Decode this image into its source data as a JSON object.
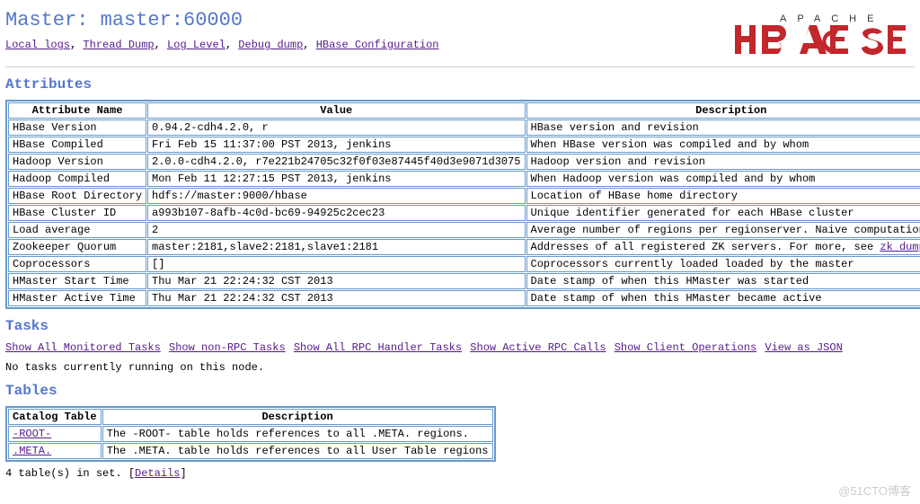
{
  "header": {
    "title": "Master: master:60000",
    "links": [
      "Local logs",
      "Thread Dump",
      "Log Level",
      "Debug dump",
      "HBase Configuration"
    ]
  },
  "sections": {
    "attributes": "Attributes",
    "tasks": "Tasks",
    "tables": "Tables"
  },
  "attributes": {
    "headers": [
      "Attribute Name",
      "Value",
      "Description"
    ],
    "rows": [
      {
        "name": "HBase Version",
        "value": "0.94.2-cdh4.2.0, r",
        "desc": "HBase version and revision"
      },
      {
        "name": "HBase Compiled",
        "value": "Fri Feb 15 11:37:00 PST 2013, jenkins",
        "desc": "When HBase version was compiled and by whom"
      },
      {
        "name": "Hadoop Version",
        "value": "2.0.0-cdh4.2.0, r7e221b24705c32f0f03e87445f40d3e9071d3075",
        "desc": "Hadoop version and revision"
      },
      {
        "name": "Hadoop Compiled",
        "value": "Mon Feb 11 12:27:15 PST 2013, jenkins",
        "desc": "When Hadoop version was compiled and by whom"
      },
      {
        "name": "HBase Root Directory",
        "value": "hdfs://master:9000/hbase",
        "desc": "Location of HBase home directory"
      },
      {
        "name": "HBase Cluster ID",
        "value": "a993b107-8afb-4c0d-bc69-94925c2cec23",
        "desc": "Unique identifier generated for each HBase cluster"
      },
      {
        "name": "Load average",
        "value": "2",
        "desc": "Average number of regions per regionserver. Naive computation."
      },
      {
        "name": "Zookeeper Quorum",
        "value": "master:2181,slave2:2181,slave1:2181",
        "desc_prefix": "Addresses of all registered ZK servers. For more, see ",
        "desc_link": "zk dump",
        "desc_suffix": "."
      },
      {
        "name": "Coprocessors",
        "value": "[]",
        "desc": "Coprocessors currently loaded loaded by the master"
      },
      {
        "name": "HMaster Start Time",
        "value": "Thu Mar 21 22:24:32 CST 2013",
        "desc": "Date stamp of when this HMaster was started"
      },
      {
        "name": "HMaster Active Time",
        "value": "Thu Mar 21 22:24:32 CST 2013",
        "desc": "Date stamp of when this HMaster became active"
      }
    ]
  },
  "tasks": {
    "links": [
      "Show All Monitored Tasks",
      "Show non-RPC Tasks",
      "Show All RPC Handler Tasks",
      "Show Active RPC Calls",
      "Show Client Operations",
      "View as JSON"
    ],
    "empty": "No tasks currently running on this node."
  },
  "tables": {
    "headers": [
      "Catalog Table",
      "Description"
    ],
    "rows": [
      {
        "name": "-ROOT-",
        "desc": "The -ROOT- table holds references to all .META. regions."
      },
      {
        "name": ".META.",
        "desc": "The .META. table holds references to all User Table regions"
      }
    ],
    "footer_prefix": "4 table(s) in set. [",
    "footer_link": "Details",
    "footer_suffix": "]"
  },
  "watermark": "@51CTO博客"
}
